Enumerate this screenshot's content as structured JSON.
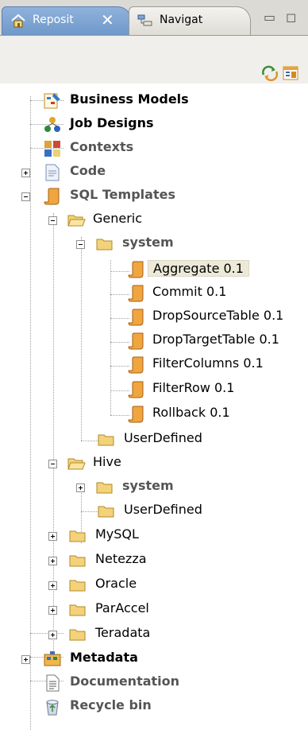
{
  "tabs": [
    {
      "label": "Reposit",
      "active": true
    },
    {
      "label": "Navigat",
      "active": false
    }
  ],
  "tree": [
    {
      "label": "Business Models",
      "bold": true,
      "icon": "business-models-icon"
    },
    {
      "label": "Job Designs",
      "bold": true,
      "icon": "job-designs-icon"
    },
    {
      "label": "Contexts",
      "bold": true,
      "gray": true,
      "icon": "contexts-icon"
    },
    {
      "label": "Code",
      "bold": true,
      "gray": true,
      "icon": "code-icon",
      "expand": "plus"
    },
    {
      "label": "SQL Templates",
      "bold": true,
      "gray": true,
      "icon": "sql-templates-icon",
      "expand": "minus"
    },
    {
      "label": "Generic",
      "icon": "folder-open-icon",
      "expand": "minus"
    },
    {
      "label": "system",
      "bold": true,
      "gray": true,
      "icon": "folder-icon",
      "expand": "minus"
    },
    {
      "label": "Aggregate 0.1",
      "icon": "sql-template-icon",
      "selected": true
    },
    {
      "label": "Commit 0.1",
      "icon": "sql-template-icon"
    },
    {
      "label": "DropSourceTable 0.1",
      "icon": "sql-template-icon"
    },
    {
      "label": "DropTargetTable 0.1",
      "icon": "sql-template-icon"
    },
    {
      "label": "FilterColumns 0.1",
      "icon": "sql-template-icon"
    },
    {
      "label": "FilterRow 0.1",
      "icon": "sql-template-icon"
    },
    {
      "label": "Rollback 0.1",
      "icon": "sql-template-icon"
    },
    {
      "label": "UserDefined",
      "icon": "folder-icon"
    },
    {
      "label": "Hive",
      "icon": "folder-open-icon",
      "expand": "minus"
    },
    {
      "label": "system",
      "bold": true,
      "gray": true,
      "icon": "folder-icon",
      "expand": "plus"
    },
    {
      "label": "UserDefined",
      "icon": "folder-icon"
    },
    {
      "label": "MySQL",
      "icon": "folder-icon",
      "expand": "plus"
    },
    {
      "label": "Netezza",
      "icon": "folder-icon",
      "expand": "plus"
    },
    {
      "label": "Oracle",
      "icon": "folder-icon",
      "expand": "plus"
    },
    {
      "label": "ParAccel",
      "icon": "folder-icon",
      "expand": "plus"
    },
    {
      "label": "Teradata",
      "icon": "folder-icon",
      "expand": "plus"
    },
    {
      "label": "Metadata",
      "bold": true,
      "icon": "metadata-icon",
      "expand": "plus"
    },
    {
      "label": "Documentation",
      "bold": true,
      "gray": true,
      "icon": "documentation-icon"
    },
    {
      "label": "Recycle bin",
      "bold": true,
      "gray": true,
      "icon": "recycle-bin-icon"
    }
  ]
}
